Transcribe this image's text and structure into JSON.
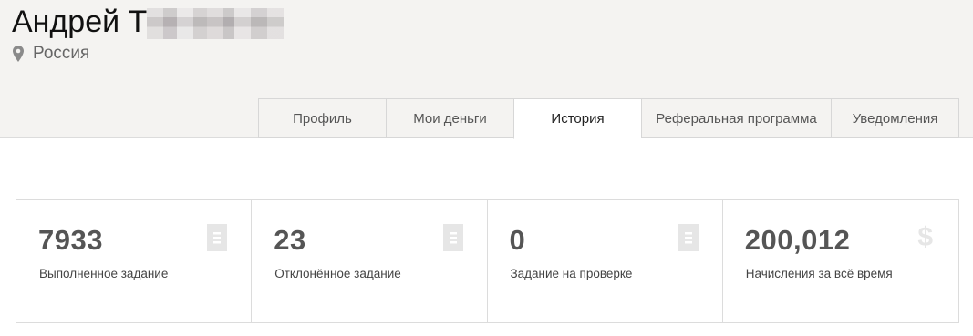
{
  "profile": {
    "name": "Андрей Т",
    "location": "Россия"
  },
  "tabs": [
    {
      "label": "Профиль",
      "active": false
    },
    {
      "label": "Мои деньги",
      "active": false
    },
    {
      "label": "История",
      "active": true
    },
    {
      "label": "Реферальная программа",
      "active": false
    },
    {
      "label": "Уведомления",
      "active": false
    }
  ],
  "stats": [
    {
      "value": "7933",
      "label": "Выполненное задание",
      "icon": "document-icon"
    },
    {
      "value": "23",
      "label": "Отклонённое задание",
      "icon": "document-icon"
    },
    {
      "value": "0",
      "label": "Задание на проверке",
      "icon": "document-icon"
    },
    {
      "value": "200,012",
      "label": "Начисления за всё время",
      "icon": "dollar-icon",
      "icon_glyph": "$"
    }
  ],
  "colors": {
    "header_bg": "#f4f3f1",
    "icon_gray": "#e6e6e6",
    "stat_value": "#555555"
  }
}
